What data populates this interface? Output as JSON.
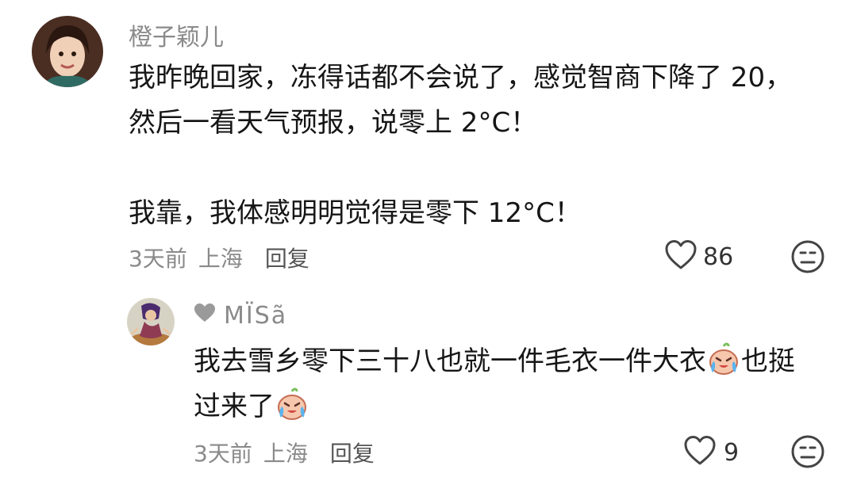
{
  "comment": {
    "username": "橙子颖儿",
    "lines": [
      "我昨晚回家，冻得话都不会说了，感觉智商下降了 20，",
      "然后一看天气预报，说零上 2°C！",
      "",
      "我靠，我体感明明觉得是零下 12°C！"
    ],
    "time": "3天前",
    "location": "上海",
    "reply_label": "回复",
    "likes": "86",
    "icons": {
      "like": "heart-outline-icon",
      "dislike": "neutral-face-icon"
    }
  },
  "reply": {
    "username": "MÏSã",
    "badge_icon": "heart-filled-icon",
    "line1_a": "我去雪乡零下三十八也就一件毛衣一件大衣",
    "line1_b": "也挺",
    "line2": "过来了",
    "emoji": "crying-laughing-emoji",
    "time": "3天前",
    "location": "上海",
    "reply_label": "回复",
    "likes": "9",
    "icons": {
      "like": "heart-outline-icon",
      "dislike": "neutral-face-icon"
    }
  },
  "colors": {
    "text": "#161616",
    "meta": "#8a8a8a",
    "icon": "#444444"
  }
}
